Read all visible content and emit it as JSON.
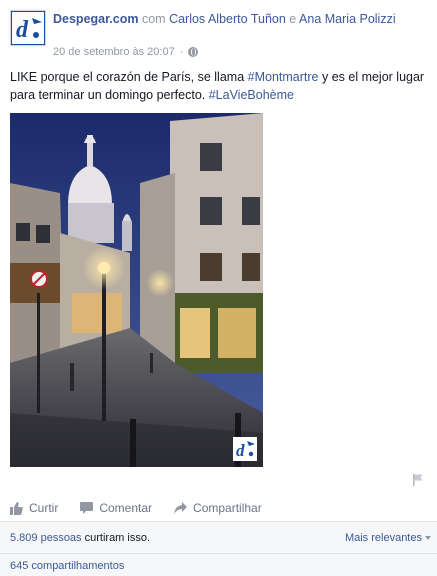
{
  "post": {
    "page_name": "Despegar.com",
    "with_word": "com",
    "tagged_1": "Carlos Alberto Tuñon",
    "and_word": "e",
    "tagged_2": "Ana Maria Polizzi",
    "timestamp": "20 de setembro às 20:07",
    "separator": "·",
    "audience_icon": "globe-icon",
    "text_before": "LIKE porque el corazón de París, se llama ",
    "hashtag_1": "#Montmartre",
    "text_middle": " y es el mejor lugar para terminar un domingo perfecto. ",
    "hashtag_2": "#LaVieBohème"
  },
  "actions": {
    "like": "Curtir",
    "comment": "Comentar",
    "share": "Compartilhar"
  },
  "stats": {
    "likes_count": "5.809 pessoas",
    "likes_suffix": " curtiram isso.",
    "sort_label": "Mais relevantes",
    "shares": "645 compartilhamentos"
  },
  "colors": {
    "link": "#3b5998",
    "muted": "#9197a3",
    "brand": "#1a4da1"
  }
}
